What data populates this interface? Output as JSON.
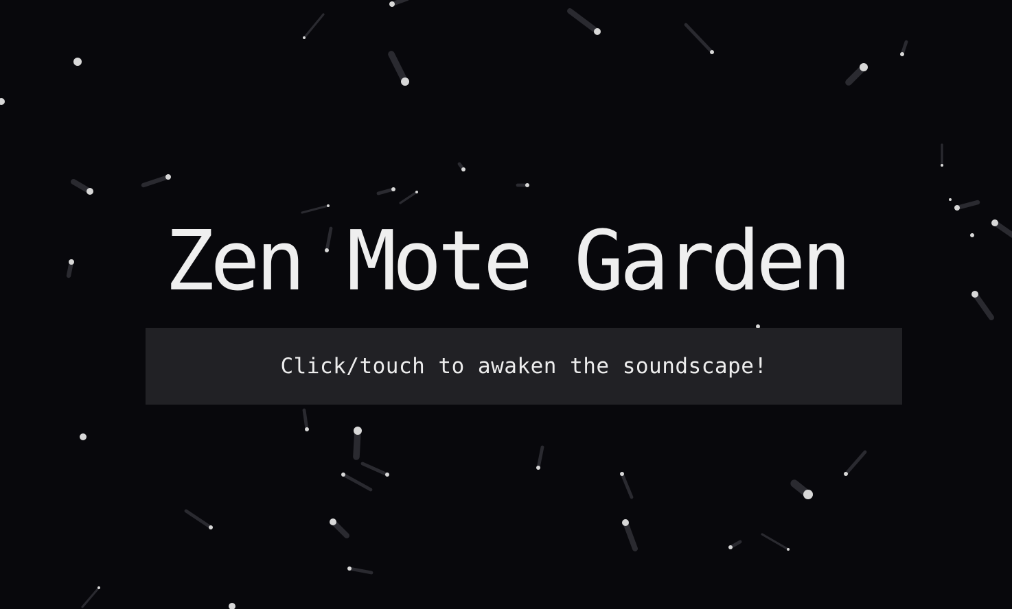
{
  "app": {
    "title": "Zen Mote Garden",
    "start_prompt": "Click/touch to awaken the soundscape!"
  },
  "colors": {
    "background": "#08080c",
    "text": "#efefef",
    "prompt_background": "#212125",
    "mote": "#d8d8d8",
    "mote_trail": "#2a2a30"
  },
  "icons": {
    "mote": "glowing-dot-icon"
  }
}
